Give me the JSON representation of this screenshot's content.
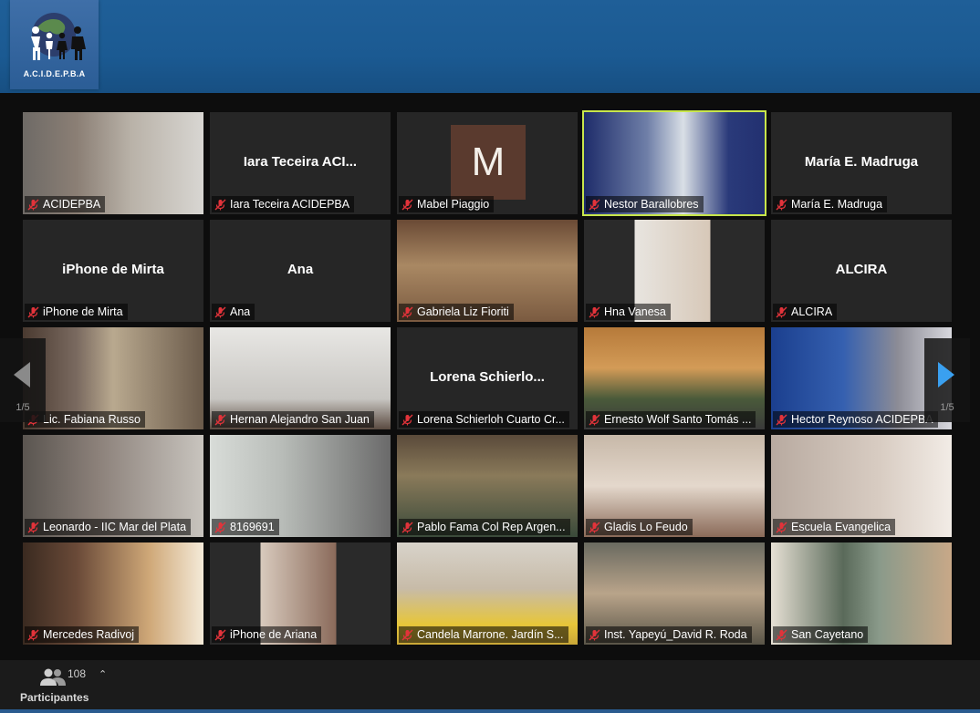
{
  "header": {
    "logo_text": "A.C.I.D.E.P.B.A",
    "colors": {
      "banner": "#1d5b94",
      "active_speaker": "#c8e64b",
      "nav_arrow": "#3aa0f0"
    }
  },
  "gallery": {
    "page_left": "1/5",
    "page_right": "1/5",
    "tiles": [
      {
        "name": "ACIDEPBA",
        "display": ""
      },
      {
        "name": "Iara Teceira ACIDEPBA",
        "display": "Iara Teceira ACI..."
      },
      {
        "name": "Mabel Piaggio",
        "display": "",
        "avatar": "M"
      },
      {
        "name": "Nestor Barallobres",
        "display": ""
      },
      {
        "name": "María E. Madruga",
        "display": "María E. Madruga"
      },
      {
        "name": "iPhone de Mirta",
        "display": "iPhone de Mirta"
      },
      {
        "name": "Ana",
        "display": "Ana"
      },
      {
        "name": "Gabriela Liz Fioriti",
        "display": ""
      },
      {
        "name": "Hna Vanesa",
        "display": ""
      },
      {
        "name": "ALCIRA",
        "display": "ALCIRA"
      },
      {
        "name": "Lic. Fabiana Russo",
        "display": ""
      },
      {
        "name": "Hernan Alejandro San Juan",
        "display": ""
      },
      {
        "name": "Lorena Schierloh Cuarto Cr...",
        "display": "Lorena  Schierlo..."
      },
      {
        "name": "Ernesto Wolf Santo Tomás ...",
        "display": ""
      },
      {
        "name": "Hector Reynoso ACIDEPBA",
        "display": ""
      },
      {
        "name": "Leonardo - IIC Mar del Plata",
        "display": ""
      },
      {
        "name": "8169691",
        "display": ""
      },
      {
        "name": "Pablo Fama Col Rep Argen...",
        "display": ""
      },
      {
        "name": "Gladis Lo Feudo",
        "display": ""
      },
      {
        "name": "Escuela Evangelica",
        "display": ""
      },
      {
        "name": "Mercedes Radivoj",
        "display": ""
      },
      {
        "name": "iPhone de Ariana",
        "display": ""
      },
      {
        "name": "Candela Marrone. Jardín S...",
        "display": ""
      },
      {
        "name": "Inst. Yapeyú_David R. Roda",
        "display": ""
      },
      {
        "name": "San Cayetano",
        "display": ""
      }
    ]
  },
  "toolbar": {
    "participants_count": "108",
    "participants_label": "Participantes"
  }
}
